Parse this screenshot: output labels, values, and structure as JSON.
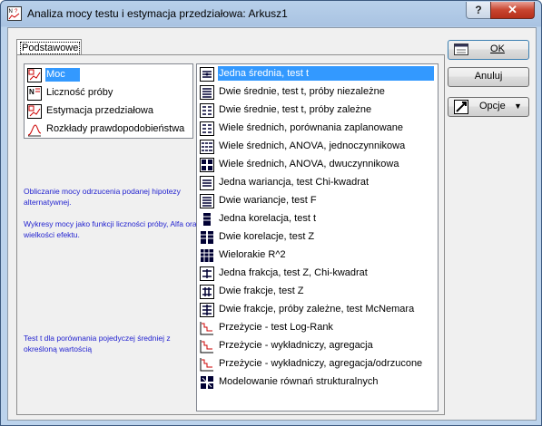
{
  "window": {
    "title": "Analiza mocy testu i estymacja przedziałowa: Arkusz1",
    "help_label": "?",
    "close_label": "✕"
  },
  "tab": {
    "label": "Podstawowe"
  },
  "left_list": [
    {
      "label": "Moc",
      "icon": "power-icon",
      "selected": true
    },
    {
      "label": "Liczność próby",
      "icon": "sample-size-icon",
      "selected": false
    },
    {
      "label": "Estymacja przedziałowa",
      "icon": "interval-estimation-icon",
      "selected": false
    },
    {
      "label": "Rozkłady prawdopodobieństwa",
      "icon": "probability-distribution-icon",
      "selected": false
    }
  ],
  "descriptions": {
    "d1": "Obliczanie mocy odrzucenia podanej hipotezy alternatywnej.",
    "d2": "Wykresy mocy jako funkcji liczności próby, Alfa oraz wielkości efektu.",
    "d3": "Test t dla porównania pojedyczej średniej z określoną wartością"
  },
  "right_list": [
    {
      "label": "Jedna średnia, test t",
      "icon": "one-mean-icon",
      "selected": true
    },
    {
      "label": "Dwie średnie, test t, próby niezależne",
      "icon": "two-means-icon",
      "selected": false
    },
    {
      "label": "Dwie średnie, test t, próby zależne",
      "icon": "two-means-paired-icon",
      "selected": false
    },
    {
      "label": "Wiele średnich, porównania zaplanowane",
      "icon": "many-means-icon",
      "selected": false
    },
    {
      "label": "Wiele średnich, ANOVA, jednoczynnikowa",
      "icon": "anova-one-icon",
      "selected": false
    },
    {
      "label": "Wiele średnich, ANOVA, dwuczynnikowa",
      "icon": "anova-two-icon",
      "selected": false
    },
    {
      "label": "Jedna wariancja, test Chi-kwadrat",
      "icon": "one-variance-icon",
      "selected": false
    },
    {
      "label": "Dwie wariancje, test F",
      "icon": "two-variances-icon",
      "selected": false
    },
    {
      "label": "Jedna korelacja, test t",
      "icon": "one-correlation-icon",
      "selected": false
    },
    {
      "label": "Dwie korelacje, test Z",
      "icon": "two-correlations-icon",
      "selected": false
    },
    {
      "label": "Wielorakie R^2",
      "icon": "multiple-r2-icon",
      "selected": false
    },
    {
      "label": "Jedna frakcja, test Z, Chi-kwadrat",
      "icon": "one-proportion-icon",
      "selected": false
    },
    {
      "label": "Dwie frakcje, test Z",
      "icon": "two-proportions-icon",
      "selected": false
    },
    {
      "label": "Dwie frakcje, próby zależne, test McNemara",
      "icon": "mcnemar-icon",
      "selected": false
    },
    {
      "label": "Przeżycie - test Log-Rank",
      "icon": "survival-logrank-icon",
      "selected": false
    },
    {
      "label": "Przeżycie - wykładniczy, agregacja",
      "icon": "survival-exp-icon",
      "selected": false
    },
    {
      "label": "Przeżycie - wykładniczy, agregacja/odrzucone",
      "icon": "survival-exp-dropout-icon",
      "selected": false
    },
    {
      "label": "Modelowanie równań strukturalnych",
      "icon": "sem-icon",
      "selected": false
    }
  ],
  "buttons": {
    "ok": "OK",
    "cancel": "Anuluj",
    "options": "Opcje"
  },
  "colors": {
    "selection": "#3399ff",
    "description_text": "#1f1fcf",
    "titlebar": "#a9c3e2",
    "close_button": "#c8452f"
  }
}
